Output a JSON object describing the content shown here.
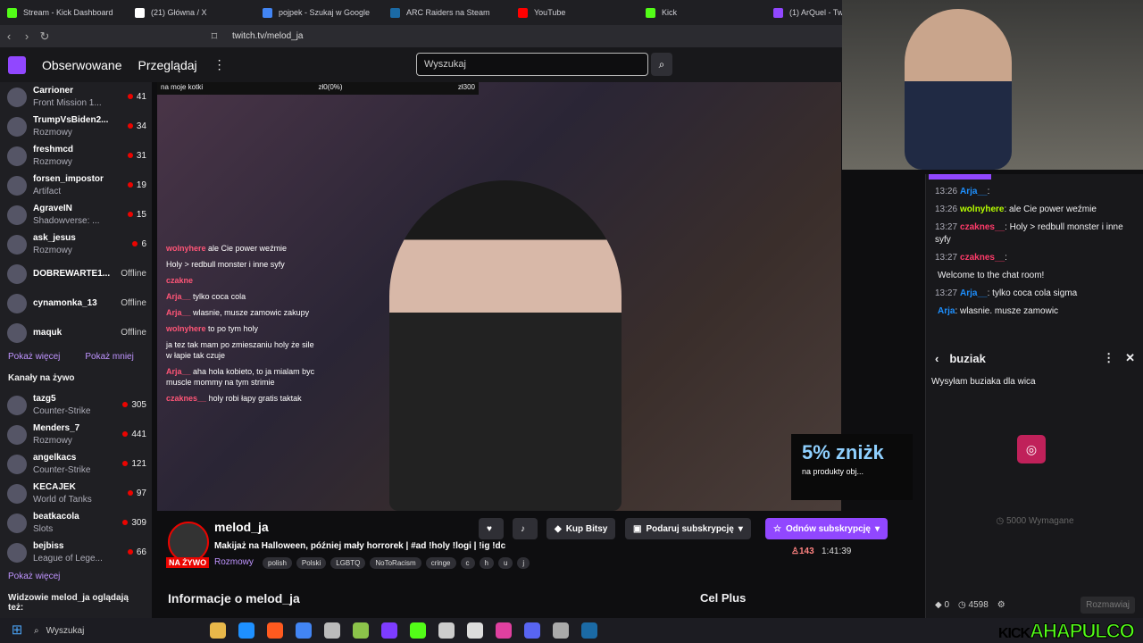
{
  "tabs": [
    {
      "label": "Stream - Kick Dashboard",
      "icon": "kick-icon",
      "color": "#53fc18"
    },
    {
      "label": "(21) Główna / X",
      "icon": "x-icon",
      "color": "#ffffff"
    },
    {
      "label": "pojpek - Szukaj w Google",
      "icon": "google-icon",
      "color": "#4285f4"
    },
    {
      "label": "ARC Raiders na Steam",
      "icon": "steam-icon",
      "color": "#1b6aa5"
    },
    {
      "label": "YouTube",
      "icon": "youtube-icon",
      "color": "#ff0000"
    },
    {
      "label": "Kick",
      "icon": "kick-icon",
      "color": "#53fc18"
    },
    {
      "label": "(1) ArQuel - Twitch",
      "icon": "twitch-icon",
      "color": "#9147ff"
    }
  ],
  "browser": {
    "url": "twitch.tv/melod_ja"
  },
  "nav": {
    "followed": "Obserwowane",
    "browse": "Przeglądaj",
    "search_placeholder": "Wyszukaj"
  },
  "sidebar": {
    "followed": [
      {
        "name": "Carrioner",
        "game": "Front Mission 1...",
        "viewers": "41"
      },
      {
        "name": "TrumpVsBiden2...",
        "game": "Rozmowy",
        "viewers": "34"
      },
      {
        "name": "freshmcd",
        "game": "Rozmowy",
        "viewers": "31"
      },
      {
        "name": "forsen_impostor",
        "game": "Artifact",
        "viewers": "19"
      },
      {
        "name": "AgraveIN",
        "game": "Shadowverse: ...",
        "viewers": "15"
      },
      {
        "name": "ask_jesus",
        "game": "Rozmowy",
        "viewers": "6"
      },
      {
        "name": "DOBREWARTE1...",
        "game": "",
        "viewers": "Offline"
      },
      {
        "name": "cynamonka_13",
        "game": "",
        "viewers": "Offline"
      },
      {
        "name": "maquk",
        "game": "",
        "viewers": "Offline"
      }
    ],
    "show_more": "Pokaż więcej",
    "show_less": "Pokaż mniej",
    "live_header": "Kanały na żywo",
    "live": [
      {
        "name": "tazg5",
        "game": "Counter-Strike",
        "viewers": "305"
      },
      {
        "name": "Menders_7",
        "game": "Rozmowy",
        "viewers": "441"
      },
      {
        "name": "angelkacs",
        "game": "Counter-Strike",
        "viewers": "121"
      },
      {
        "name": "KECAJEK",
        "game": "World of Tanks",
        "viewers": "97"
      },
      {
        "name": "beatkacola",
        "game": "Slots",
        "viewers": "309"
      },
      {
        "name": "bejbiss",
        "game": "League of Lege...",
        "viewers": "66"
      }
    ],
    "show_more2": "Pokaż więcej",
    "also_watch": "Widzowie melod_ja oglądają też:"
  },
  "video": {
    "goal_label": "na moje kotki",
    "goal_current": "zł0(0%)",
    "goal_target": "zł300",
    "promo_big": "5% zniżk",
    "promo_small": "na produkty obj...",
    "overlay_chat": [
      {
        "user": "wolnyhere",
        "text": "ale Cie power weźmie"
      },
      {
        "user": "",
        "text": "Holy > redbull monster i inne syfy"
      },
      {
        "user": "czakne",
        "text": ""
      },
      {
        "user": "Arja__",
        "text": "tylko coca cola"
      },
      {
        "user": "Arja__",
        "text": "wlasnie, musze zamowic zakupy"
      },
      {
        "user": "wolnyhere",
        "text": "to po tym holy"
      },
      {
        "user": "",
        "text": "ja tez tak mam po zmieszaniu holy że sile w łapie tak czuje"
      },
      {
        "user": "Arja__",
        "text": "aha hola kobieto, to ja mialam byc muscle mommy na tym strimie"
      },
      {
        "user": "czaknes__",
        "text": "holy robi łapy gratis taktak"
      }
    ]
  },
  "stream": {
    "name": "melod_ja",
    "title": "Makijaż na Halloween, później mały horrorek | #ad !holy !logi | !ig !dc",
    "live_label": "NA ŻYWO",
    "category": "Rozmowy",
    "tags": [
      "polish",
      "Polski",
      "LGBTQ",
      "NoToRacism",
      "cringe",
      "c",
      "h",
      "u",
      "j"
    ],
    "bits_label": "Kup Bitsy",
    "gift_label": "Podaruj subskrypcję",
    "renew_label": "Odnów subskrypcję",
    "viewers": "143",
    "uptime": "1:41:39",
    "about": "Informacje o melod_ja",
    "goal": "Cel Plus"
  },
  "chat": {
    "messages": [
      {
        "time": "13:26",
        "user": "Arja__",
        "text": ":",
        "cls": "u1"
      },
      {
        "time": "13:26",
        "user": "wolnyhere",
        "text": ": ale Cie power weźmie",
        "cls": "u2"
      },
      {
        "time": "13:27",
        "user": "czaknes__",
        "text": ": Holy > redbull monster i inne syfy",
        "cls": "u3"
      },
      {
        "time": "13:27",
        "user": "czaknes__",
        "text": ":",
        "cls": "u3"
      },
      {
        "time": "",
        "user": "",
        "text": "Welcome to the chat room!",
        "cls": ""
      },
      {
        "time": "13:27",
        "user": "Arja__",
        "text": ": tylko coca cola sigma",
        "cls": "u1"
      },
      {
        "time": "",
        "user": "Arja",
        "text": ": wlasnie. musze zamowic",
        "cls": "u1"
      }
    ],
    "popup": {
      "title": "buziak",
      "message": "Wysyłam buziaka dla wica",
      "required": "5000 Wymagane"
    },
    "bits": "0",
    "points": "4598",
    "send": "Rozmawiaj"
  },
  "taskbar": {
    "search": "Wyszukaj"
  },
  "brand": {
    "kick": "KICK",
    "name": "AHAPULCO"
  }
}
